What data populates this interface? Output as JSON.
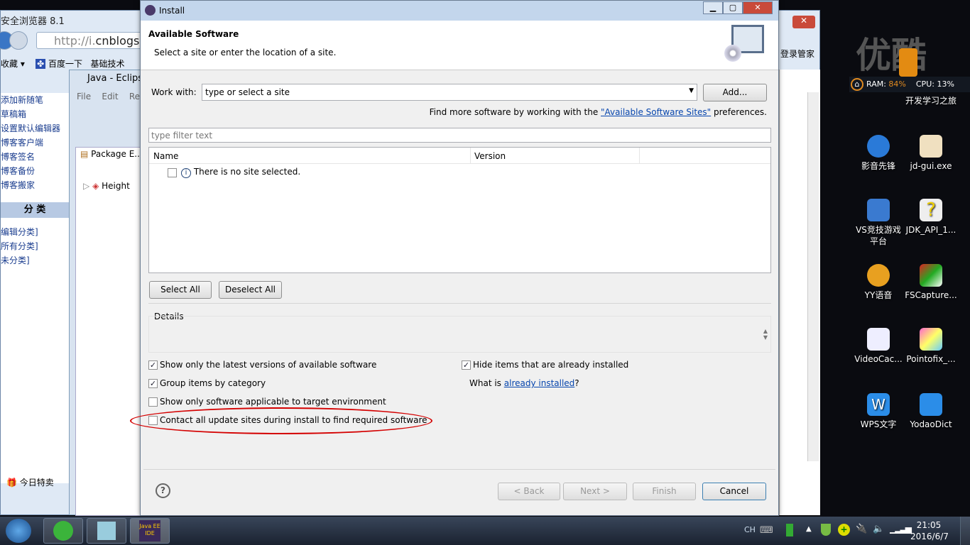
{
  "browser": {
    "title": "安全浏览器 8.1",
    "url_prefix": "http://i.",
    "url_host": "cnblogs.",
    "favorites": [
      "收藏 ▾",
      "百度一下",
      "基础技术"
    ],
    "sidebar": [
      "添加新随笔",
      "草稿箱",
      "设置默认编辑器",
      "博客客户端",
      "博客签名",
      "博客备份",
      "博客搬家"
    ],
    "category_header": "分  类",
    "categories": [
      "编辑分类]",
      "所有分类]",
      "未分类]"
    ],
    "today": "今日特卖",
    "right_link": "登录管家"
  },
  "eclipse": {
    "title": "Java - Eclipse",
    "menu": [
      "File",
      "Edit",
      "Re"
    ],
    "package_explorer": "Package E...",
    "project": "Height"
  },
  "dialog": {
    "title": "Install",
    "header_title": "Available Software",
    "header_subtitle": "Select a site or enter the location of a site.",
    "work_with_label": "Work with:",
    "work_with_value": "type or select a site",
    "add_button": "Add...",
    "find_more_prefix": "Find more software by working with the ",
    "find_more_link": "\"Available Software Sites\"",
    "find_more_suffix": " preferences.",
    "filter_placeholder": "type filter text",
    "columns": [
      "Name",
      "Version"
    ],
    "empty_row": "There is no site selected.",
    "select_all": "Select All",
    "deselect_all": "Deselect All",
    "details_label": "Details",
    "options": [
      {
        "label": "Show only the latest versions of available software",
        "checked": true
      },
      {
        "label": "Group items by category",
        "checked": true
      },
      {
        "label": "Show only software applicable to target environment",
        "checked": false
      },
      {
        "label": "Contact all update sites during install to find required software",
        "checked": false
      }
    ],
    "hide_installed": {
      "label": "Hide items that are already installed",
      "checked": true
    },
    "what_is_prefix": "What is ",
    "what_is_link": "already installed",
    "what_is_suffix": "?",
    "back": "< Back",
    "next": "Next >",
    "finish": "Finish",
    "cancel": "Cancel",
    "highlight_color": "#d40000"
  },
  "desktop": {
    "watermark": "优酷",
    "ram_label": "RAM: ",
    "ram_value": "84%",
    "cpu": "CPU: 13%",
    "folder_label": "开发学习之旅",
    "icons": [
      "影音先锋",
      "jd-gui.exe",
      "VS竞技游戏平台",
      "JDK_API_1...",
      "YY语音",
      "FSCapture...",
      "VideoCac...",
      "Pointofix_...",
      "WPS文字",
      "YodaoDict"
    ]
  },
  "taskbar": {
    "lang": "CH",
    "time": "21:05",
    "date": "2016/6/7",
    "java_ee": "Java EE IDE"
  }
}
